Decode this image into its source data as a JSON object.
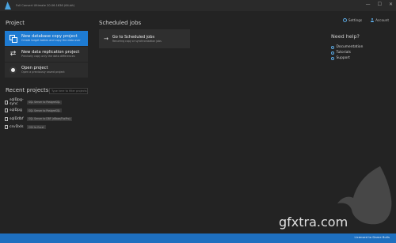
{
  "window": {
    "title": "Full Convert Ultimate 20.06.1636 (64-bit)",
    "controls": [
      "—",
      "☐",
      "✕"
    ]
  },
  "top_links": {
    "settings": "Settings",
    "account": "Account"
  },
  "project": {
    "title": "Project",
    "cards": [
      {
        "title": "New database copy project",
        "subtitle": "Create target tables and copy the data over"
      },
      {
        "title": "New data replication project",
        "subtitle": "Precisely copy only the data differences"
      },
      {
        "title": "Open project",
        "subtitle": "Open a previously saved project"
      }
    ]
  },
  "recent": {
    "title": "Recent projects",
    "filter_placeholder": "Type here to filter projects",
    "items": [
      {
        "name": "sqlDpg-sync",
        "tag": "SQL Server to PostgreSQL"
      },
      {
        "name": "sqlDpg",
        "tag": "SQL Server to PostgreSQL"
      },
      {
        "name": "sqlDdbf",
        "tag": "SQL Server to DBF (dBase/FoxPro)"
      },
      {
        "name": "csvDxls",
        "tag": "CSV to Excel"
      }
    ]
  },
  "scheduled": {
    "title": "Scheduled jobs",
    "card_title": "Go to Scheduled jobs",
    "card_subtitle": "Recurring copy or synchronization jobs"
  },
  "help": {
    "title": "Need help?",
    "links": [
      "Documentation",
      "Tutorials",
      "Support"
    ]
  },
  "watermark": "gfxtra.com",
  "status": "Licensed to Dame Bulls",
  "colors": {
    "accent": "#1e7bd2",
    "background": "#232323",
    "statusbar": "#1e6fbf"
  }
}
